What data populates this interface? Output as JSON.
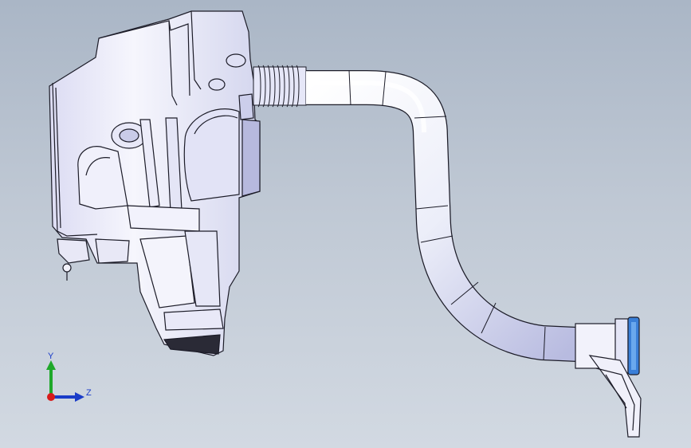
{
  "viewport": {
    "background_top": "#aab6c6",
    "background_bottom": "#d2d9e2"
  },
  "model": {
    "description_icon": "3d-cad-model",
    "part_color": "#f4f4fb",
    "shade_color": "#c9cbe8",
    "edge_color": "#1c1c28",
    "connector_color": "#3a7fd8"
  },
  "triad": {
    "y_label": "Y",
    "z_label": "Z",
    "y_color": "#1fa82a",
    "z_color": "#1a3cc8",
    "x_color": "#d81b1b"
  }
}
